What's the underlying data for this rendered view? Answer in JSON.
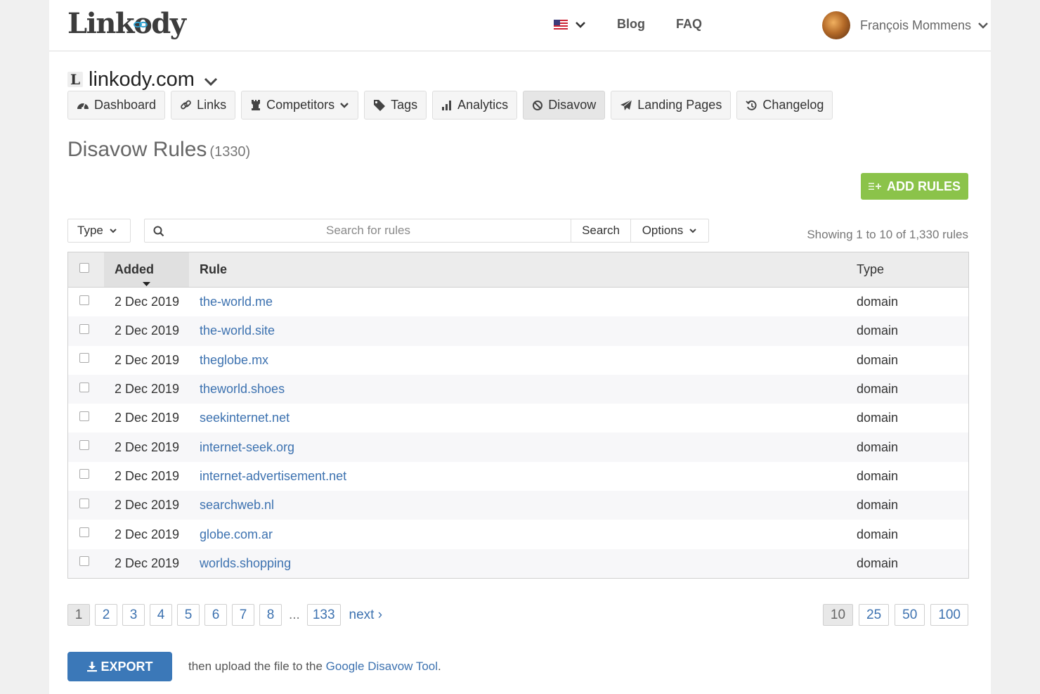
{
  "brand": {
    "logo_text": "Linkody"
  },
  "header": {
    "language_icon": "us-flag-icon",
    "links": {
      "blog": "Blog",
      "faq": "FAQ"
    },
    "user": {
      "name": "François Mommens"
    }
  },
  "site": {
    "favicon_letter": "L",
    "name": "linkody.com"
  },
  "tabs": [
    {
      "label": "Dashboard",
      "icon": "dashboard-icon"
    },
    {
      "label": "Links",
      "icon": "link-icon"
    },
    {
      "label": "Competitors",
      "icon": "rook-icon"
    },
    {
      "label": "Tags",
      "icon": "tag-icon"
    },
    {
      "label": "Analytics",
      "icon": "bar-chart-icon"
    },
    {
      "label": "Disavow",
      "icon": "ban-icon",
      "active": true
    },
    {
      "label": "Landing Pages",
      "icon": "paper-plane-icon"
    },
    {
      "label": "Changelog",
      "icon": "history-icon"
    }
  ],
  "page": {
    "title": "Disavow Rules",
    "count": "(1330)",
    "add_rules_label": "ADD RULES"
  },
  "filters": {
    "type_label": "Type",
    "search_placeholder": "Search for rules",
    "search_button": "Search",
    "options_label": "Options",
    "showing": "Showing 1 to 10 of 1,330 rules"
  },
  "table": {
    "columns": {
      "added": "Added",
      "rule": "Rule",
      "type": "Type"
    },
    "rows": [
      {
        "added": "2 Dec 2019",
        "rule": "the-world.me",
        "type": "domain"
      },
      {
        "added": "2 Dec 2019",
        "rule": "the-world.site",
        "type": "domain"
      },
      {
        "added": "2 Dec 2019",
        "rule": "theglobe.mx",
        "type": "domain"
      },
      {
        "added": "2 Dec 2019",
        "rule": "theworld.shoes",
        "type": "domain"
      },
      {
        "added": "2 Dec 2019",
        "rule": "seekinternet.net",
        "type": "domain"
      },
      {
        "added": "2 Dec 2019",
        "rule": "internet-seek.org",
        "type": "domain"
      },
      {
        "added": "2 Dec 2019",
        "rule": "internet-advertisement.net",
        "type": "domain"
      },
      {
        "added": "2 Dec 2019",
        "rule": "searchweb.nl",
        "type": "domain"
      },
      {
        "added": "2 Dec 2019",
        "rule": "globe.com.ar",
        "type": "domain"
      },
      {
        "added": "2 Dec 2019",
        "rule": "worlds.shopping",
        "type": "domain"
      }
    ]
  },
  "pagination": {
    "pages": [
      "1",
      "2",
      "3",
      "4",
      "5",
      "6",
      "7",
      "8"
    ],
    "current": "1",
    "ellipsis": "...",
    "last": "133",
    "next": "next ›",
    "page_sizes": [
      "10",
      "25",
      "50",
      "100"
    ],
    "current_size": "10"
  },
  "export": {
    "label": "EXPORT",
    "note_prefix": "then upload the file to the ",
    "note_link": "Google Disavow Tool",
    "note_suffix": "."
  },
  "colors": {
    "accent_green": "#8bc34a",
    "accent_blue": "#3b78b8",
    "link": "#3d72b0"
  }
}
